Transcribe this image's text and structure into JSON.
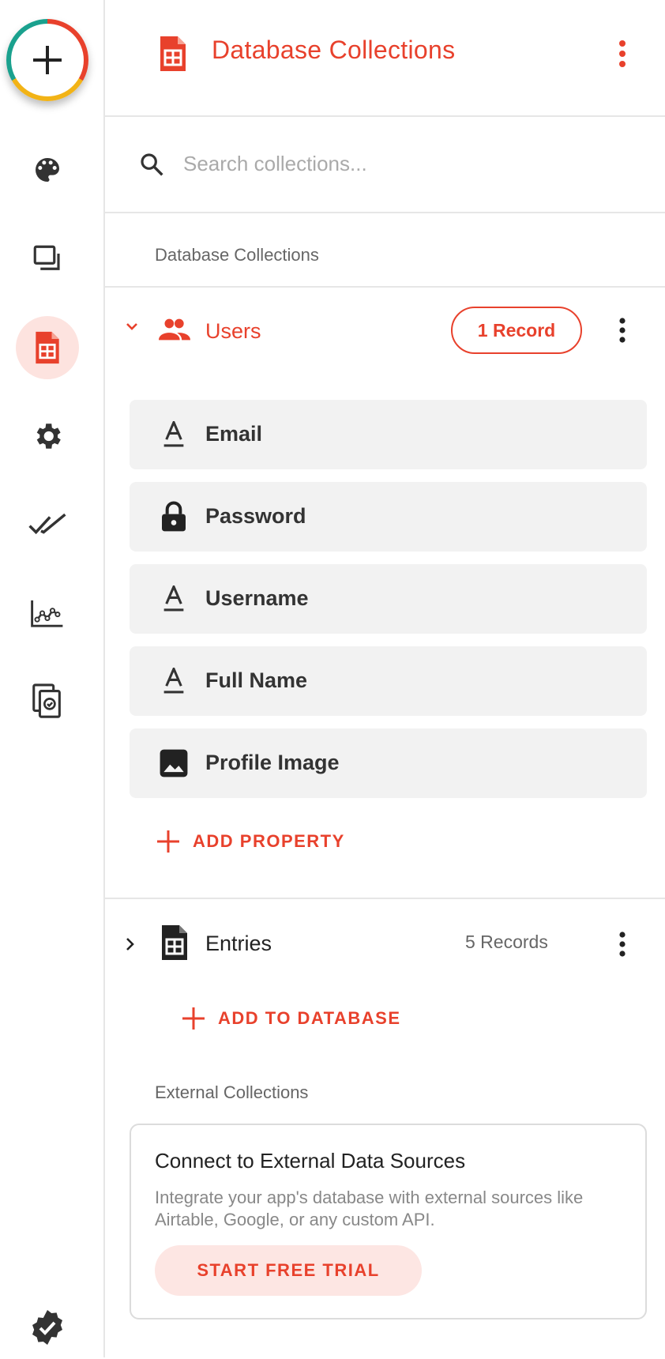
{
  "header": {
    "title": "Database Collections"
  },
  "search": {
    "placeholder": "Search collections..."
  },
  "sections": {
    "database": "Database Collections",
    "external": "External Collections"
  },
  "collections": {
    "users": {
      "name": "Users",
      "records": "1 Record",
      "properties": [
        {
          "label": "Email",
          "icon": "text-icon"
        },
        {
          "label": "Password",
          "icon": "lock-icon"
        },
        {
          "label": "Username",
          "icon": "text-icon"
        },
        {
          "label": "Full Name",
          "icon": "text-icon"
        },
        {
          "label": "Profile Image",
          "icon": "image-icon"
        }
      ],
      "add_property": "ADD PROPERTY"
    },
    "entries": {
      "name": "Entries",
      "records": "5 Records"
    }
  },
  "add_to_database": "ADD TO DATABASE",
  "external_card": {
    "title": "Connect to External Data Sources",
    "description": "Integrate your app's database with external sources like Airtable, Google, or any custom API.",
    "cta": "START FREE TRIAL"
  },
  "colors": {
    "accent": "#e8412c",
    "accent_light": "#fde3df"
  }
}
